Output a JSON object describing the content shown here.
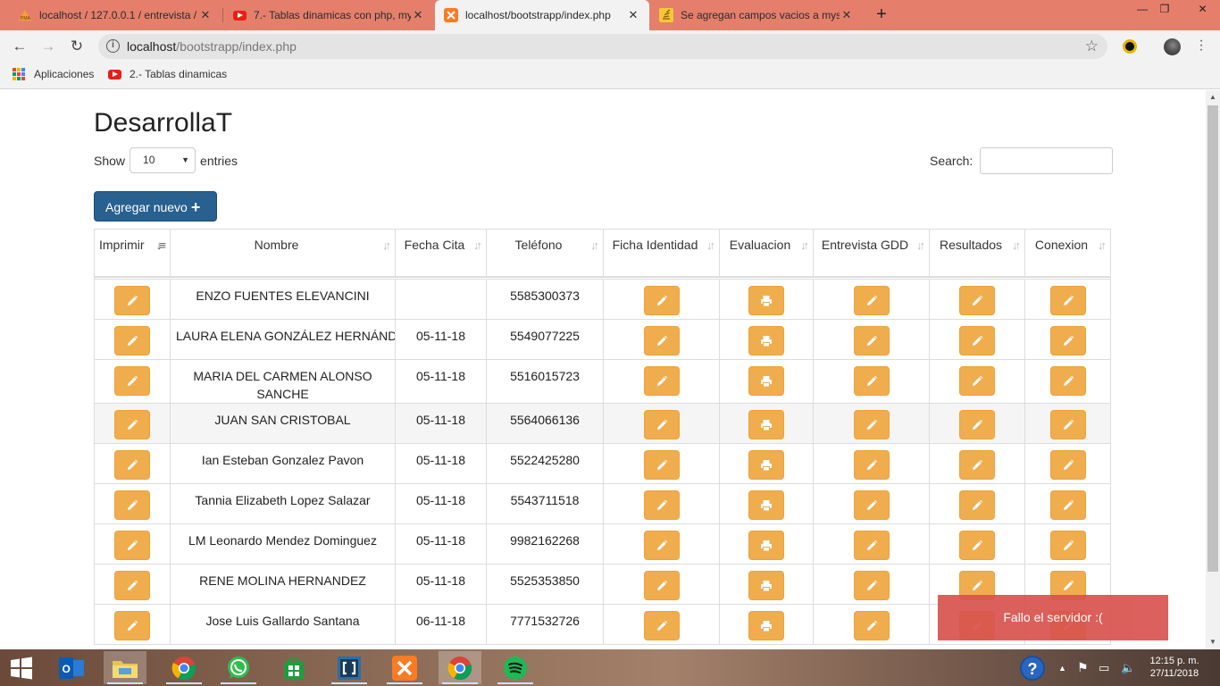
{
  "browser": {
    "tabs": [
      {
        "title": "localhost / 127.0.0.1 / entrevista /",
        "icon": "phpmyadmin-icon",
        "active": false
      },
      {
        "title": "7.- Tablas dinamicas con php, my",
        "icon": "youtube-icon",
        "active": false
      },
      {
        "title": "localhost/bootstrapp/index.php",
        "icon": "xampp-icon",
        "active": true
      },
      {
        "title": "Se agregan campos vacios a mys",
        "icon": "stackoverflow-icon",
        "active": false
      }
    ],
    "url_host": "localhost",
    "url_path": "/bootstrapp/index.php",
    "bookmarks": [
      {
        "label": "Aplicaciones",
        "icon": "apps-grid-icon"
      },
      {
        "label": "2.- Tablas dinamicas",
        "icon": "youtube-icon"
      }
    ]
  },
  "page": {
    "title": "DesarrollaT",
    "show_label": "Show",
    "entries_value": "10",
    "entries_label": "entries",
    "search_label": "Search:",
    "add_button_label": "Agregar nuevo"
  },
  "table": {
    "columns": [
      "Imprimir",
      "Nombre",
      "Fecha Cita",
      "Teléfono",
      "Ficha Identidad",
      "Evaluacion",
      "Entrevista GDD",
      "Resultados",
      "Conexion"
    ],
    "rows": [
      {
        "nombre": "ENZO FUENTES ELEVANCINI",
        "fecha": "",
        "telefono": "5585300373"
      },
      {
        "nombre": "LAURA ELENA GONZÁLEZ HERNÁND",
        "fecha": "05-11-18",
        "telefono": "5549077225"
      },
      {
        "nombre": "MARIA DEL CARMEN ALONSO SANCHE",
        "fecha": "05-11-18",
        "telefono": "5516015723"
      },
      {
        "nombre": "JUAN SAN CRISTOBAL",
        "fecha": "05-11-18",
        "telefono": "5564066136"
      },
      {
        "nombre": "Ian Esteban Gonzalez Pavon",
        "fecha": "05-11-18",
        "telefono": "5522425280"
      },
      {
        "nombre": "Tannia Elizabeth Lopez Salazar",
        "fecha": "05-11-18",
        "telefono": "5543711518"
      },
      {
        "nombre": "LM Leonardo Mendez Dominguez",
        "fecha": "05-11-18",
        "telefono": "9982162268"
      },
      {
        "nombre": "RENE MOLINA HERNANDEZ",
        "fecha": "05-11-18",
        "telefono": "5525353850"
      },
      {
        "nombre": "Jose Luis Gallardo Santana",
        "fecha": "06-11-18",
        "telefono": "7771532726"
      }
    ]
  },
  "toast": {
    "message": "Fallo el servidor :("
  },
  "taskbar": {
    "apps": [
      "outlook-icon",
      "file-explorer-icon",
      "chrome-icon",
      "whatsapp-icon",
      "store-icon",
      "brackets-icon",
      "xampp-icon",
      "chrome-icon",
      "spotify-icon"
    ],
    "time": "12:15 p. m.",
    "date": "27/11/2018"
  },
  "colors": {
    "tabstrip": "#e57f6b",
    "primary_button": "#286090",
    "warning_button": "#f0ad4e",
    "toast": "#d9534f"
  }
}
